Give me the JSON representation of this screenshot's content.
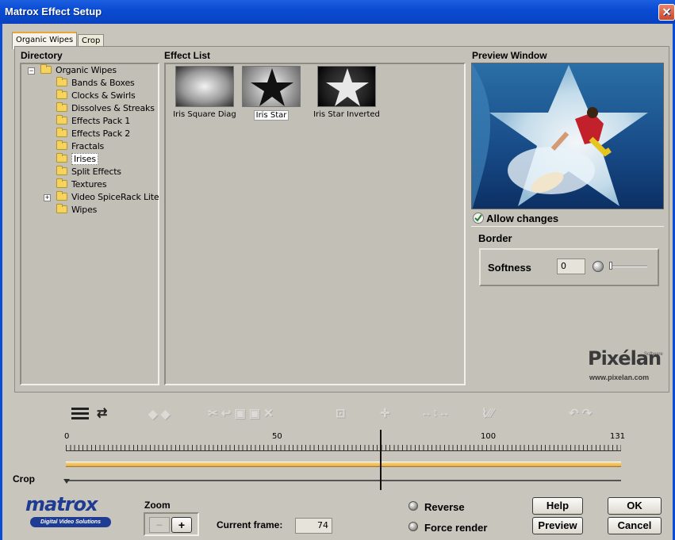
{
  "window": {
    "title": "Matrox Effect Setup",
    "close_glyph": "✕"
  },
  "tabs": [
    {
      "label": "Organic Wipes",
      "active": true
    },
    {
      "label": "Crop",
      "active": false
    }
  ],
  "directory": {
    "heading": "Directory",
    "root": "Organic Wipes",
    "items": [
      "Bands & Boxes",
      "Clocks & Swirls",
      "Dissolves & Streaks",
      "Effects Pack 1",
      "Effects Pack 2",
      "Fractals",
      "Irises",
      "Split Effects",
      "Textures",
      "Video SpiceRack Lite",
      "Wipes"
    ],
    "selected": "Irises",
    "collapsed_glyph": "+",
    "expanded_glyph": "−"
  },
  "effect_list": {
    "heading": "Effect List",
    "items": [
      {
        "label": "Iris Square Diag",
        "selected": false
      },
      {
        "label": "Iris Star",
        "selected": true
      },
      {
        "label": "Iris Star Inverted",
        "selected": false
      }
    ]
  },
  "preview": {
    "heading": "Preview Window"
  },
  "allow_changes": {
    "label": "Allow changes",
    "checked": true
  },
  "border": {
    "heading": "Border",
    "softness_label": "Softness",
    "softness_value": "0"
  },
  "logo": {
    "pixelan": "Pixélan",
    "pixelan_small": "Software",
    "url": "www.pixelan.com"
  },
  "timeline": {
    "ticks": [
      "0",
      "50",
      "100",
      "131"
    ],
    "track_label": "Crop",
    "current_frame_fraction": 0.565
  },
  "matrox": {
    "logo": "matrox",
    "tagline": "Digital Video Solutions"
  },
  "zoom": {
    "label": "Zoom",
    "minus": "−",
    "plus": "+"
  },
  "current_frame": {
    "label": "Current frame:",
    "value": "74"
  },
  "options": {
    "reverse": "Reverse",
    "force_render": "Force render"
  },
  "buttons": {
    "help": "Help",
    "ok": "OK",
    "preview": "Preview",
    "cancel": "Cancel"
  },
  "colors": {
    "titlebar": "#0a4cd4",
    "track": "#f0b84a",
    "accent": "#e8a53b"
  }
}
